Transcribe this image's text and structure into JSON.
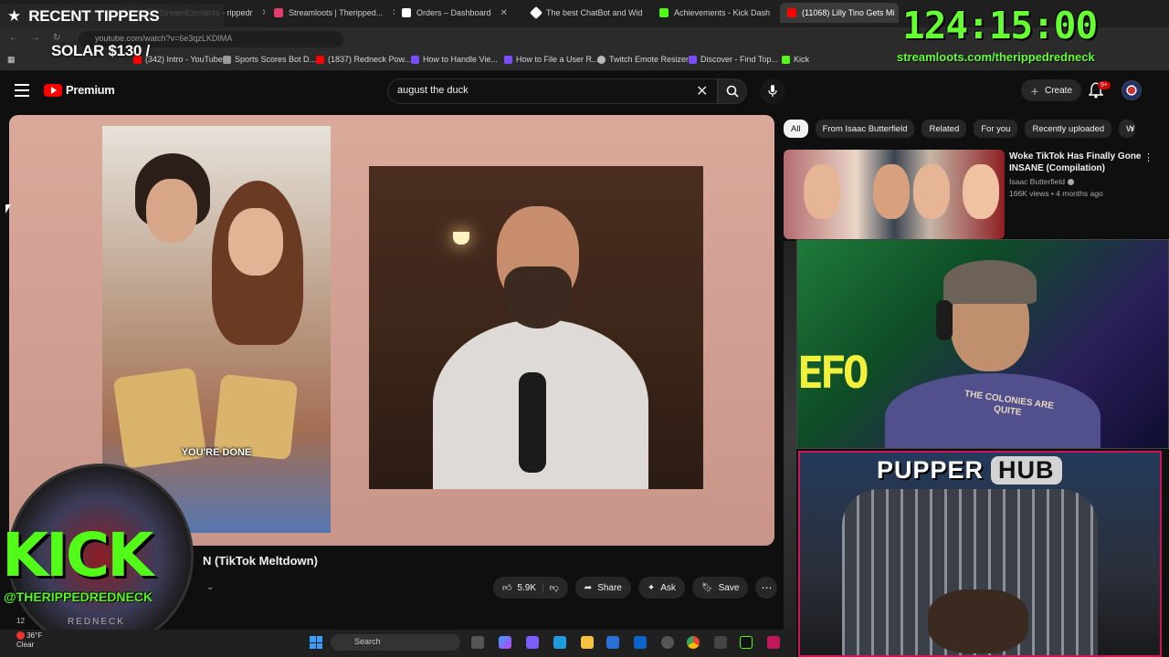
{
  "browser": {
    "tabs": [
      {
        "label": "StreamElements - rippedr",
        "color": "#444"
      },
      {
        "label": "Streamloots | Theripped...",
        "color": "#e33b6b"
      },
      {
        "label": "Orders – Dashboard",
        "color": "#ffffff"
      },
      {
        "label": "The best ChatBot and Wid",
        "color": "#ffffff"
      },
      {
        "label": "Achievements - Kick Dash",
        "color": "#53fc18"
      },
      {
        "label": "(11068) Lilly Tino Gets Mi",
        "color": "#ff0000"
      }
    ],
    "url": "youtube.com/watch?v=6e3qzLKDIMA",
    "bookmarks": [
      {
        "label": "(342) Intro - YouTube",
        "color": "#ff0000"
      },
      {
        "label": "Sports Scores Bot D...",
        "color": "#999"
      },
      {
        "label": "(1837) Redneck Pow...",
        "color": "#ff0000"
      },
      {
        "label": "How to Handle Vie...",
        "color": "#7b4bff"
      },
      {
        "label": "How to File a User R...",
        "color": "#7b4bff"
      },
      {
        "label": "Twitch Emote Resizer",
        "color": "#bbb"
      },
      {
        "label": "Discover - Find Top...",
        "color": "#7b4bff"
      },
      {
        "label": "Kick",
        "color": "#53fc18"
      }
    ]
  },
  "youtube": {
    "logo_text": "Premium",
    "search_value": "august the duck",
    "create_label": "Create",
    "notif_count": "9+",
    "video": {
      "caption": "YOU'RE DONE",
      "title_visible": "N (TikTok Meltdown)",
      "likes": "5.9K",
      "share_label": "Share",
      "ask_label": "Ask",
      "save_label": "Save"
    },
    "chips": [
      "All",
      "From Isaac Butterfield",
      "Related",
      "For you",
      "Recently uploaded",
      "W"
    ],
    "recommendation": {
      "title": "Woke TikTok Has Finally Gone INSANE (Compilation)",
      "channel": "Isaac Butterfield",
      "meta": "166K views • 4 months ago"
    }
  },
  "overlay": {
    "recent_title": "RECENT TIPPERS",
    "tipper": "SOLAR $130 /",
    "timer": "124:15:00",
    "streamloots_url": "streamloots.com/therippedredneck",
    "kick_word": "KICK",
    "kick_handle": "@THERIPPEDREDNECK",
    "kick_sub": "REDNECK",
    "cam_shirt_text": "THE COLONIES ARE QUITE",
    "cam_sign": "EFO",
    "pupper_word1": "PUPPER",
    "pupper_word2": "HUB"
  },
  "taskbar": {
    "temperature": "36°F",
    "condition": "Clear",
    "search_label": "Search",
    "side_count": "12"
  }
}
